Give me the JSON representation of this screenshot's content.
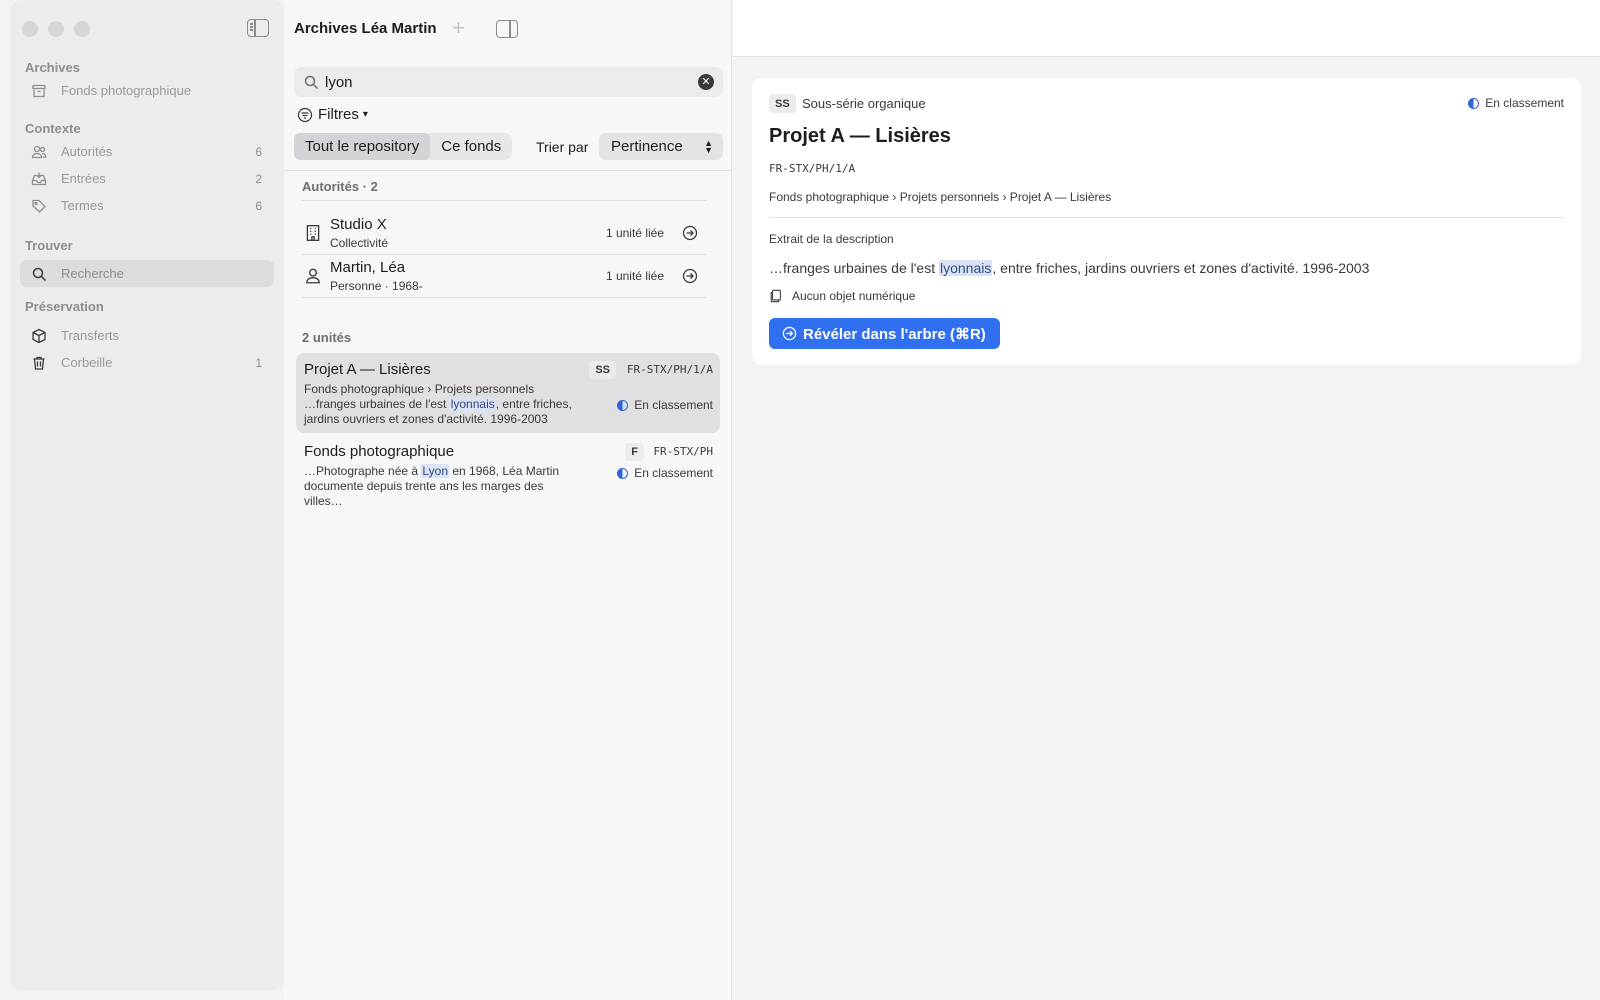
{
  "window": {
    "title": "Archives Léa Martin"
  },
  "sidebar": {
    "sections": [
      {
        "title": "Archives",
        "items": [
          {
            "label": "Fonds photographique",
            "icon": "archive-box-icon",
            "count": ""
          }
        ]
      },
      {
        "title": "Contexte",
        "items": [
          {
            "label": "Autorités",
            "icon": "people-icon",
            "count": "6"
          },
          {
            "label": "Entrées",
            "icon": "inbox-tray-icon",
            "count": "2"
          },
          {
            "label": "Termes",
            "icon": "tag-icon",
            "count": "6"
          }
        ]
      },
      {
        "title": "Trouver",
        "items": [
          {
            "label": "Recherche",
            "icon": "search-icon",
            "count": ""
          }
        ]
      },
      {
        "title": "Préservation",
        "items": [
          {
            "label": "Transferts",
            "icon": "package-icon",
            "count": ""
          },
          {
            "label": "Corbeille",
            "icon": "trash-icon",
            "count": "1"
          }
        ]
      }
    ]
  },
  "search": {
    "value": "lyon",
    "filters_label": "Filtres",
    "scope_options": [
      "Tout le repository",
      "Ce fonds"
    ],
    "scope_selected": "Tout le repository",
    "sort_label": "Trier par",
    "sort_value": "Pertinence"
  },
  "results": {
    "authorities_header": "Autorités · 2",
    "authorities": [
      {
        "name": "Studio X",
        "sub": "Collectivité",
        "linked": "1 unité liée",
        "icon": "building-icon"
      },
      {
        "name": "Martin, Léa",
        "sub": "Personne · 1968-",
        "linked": "1 unité liée",
        "icon": "person-icon"
      }
    ],
    "units_header": "2 unités",
    "units": [
      {
        "title": "Projet A — Lisières",
        "badge": "SS",
        "ref": "FR-STX/PH/1/A",
        "path": "Fonds photographique › Projets personnels",
        "snippet_before": "…franges urbaines de l'est ",
        "snippet_match": "lyonnais",
        "snippet_after": ", entre friches, jardins ouvriers et zones d'activité. 1996-2003",
        "status": "En classement"
      },
      {
        "title": "Fonds photographique",
        "badge": "F",
        "ref": "FR-STX/PH",
        "path": "",
        "snippet_before": "…Photographe née à ",
        "snippet_match": "Lyon",
        "snippet_after": " en 1968, Léa Martin documente depuis trente ans les marges des villes…",
        "status": "En classement"
      }
    ]
  },
  "detail": {
    "badge": "SS",
    "type": "Sous-série organique",
    "status": "En classement",
    "title": "Projet A — Lisières",
    "ref": "FR-STX/PH/1/A",
    "path": "Fonds photographique › Projets personnels › Projet A — Lisières",
    "excerpt_label": "Extrait de la description",
    "snippet_before": "…franges urbaines de l'est ",
    "snippet_match": "lyonnais",
    "snippet_after": ", entre friches, jardins ouvriers et zones d'activité. 1996-2003",
    "digital_label": "Aucun objet numérique",
    "reveal_button": "Révéler dans l'arbre (⌘R)"
  },
  "colors": {
    "accent": "#2f6ff0",
    "status": "#2f66d4",
    "highlight": "#dbe3f3"
  }
}
